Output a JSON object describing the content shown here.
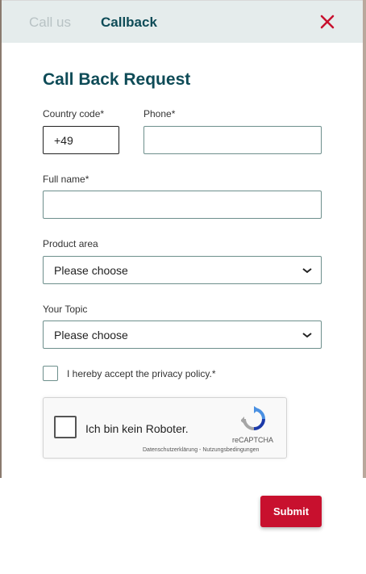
{
  "tabs": [
    {
      "label": "Call us",
      "active": false
    },
    {
      "label": "Callback",
      "active": true
    }
  ],
  "form": {
    "title": "Call Back Request",
    "country_code_label": "Country code*",
    "country_code_value": "+49",
    "phone_label": "Phone*",
    "phone_value": "",
    "full_name_label": "Full name*",
    "full_name_value": "",
    "product_area_label": "Product area",
    "product_area_value": "Please choose",
    "topic_label": "Your Topic",
    "topic_value": "Please choose",
    "privacy_label": "I hereby accept the privacy policy.*",
    "privacy_checked": false,
    "submit_label": "Submit"
  },
  "captcha": {
    "label": "Ich bin kein Roboter.",
    "brand": "reCAPTCHA",
    "links": "Datenschutzerklärung - Nutzungsbedingungen"
  },
  "colors": {
    "accent": "#0e4b57",
    "close": "#c8102e",
    "submit_bg": "#c8102e",
    "tabbar_bg": "#e5ecec"
  },
  "icons": {
    "close": "close-icon",
    "select": "chevron-down-icon",
    "captcha": "recaptcha-logo-icon"
  }
}
